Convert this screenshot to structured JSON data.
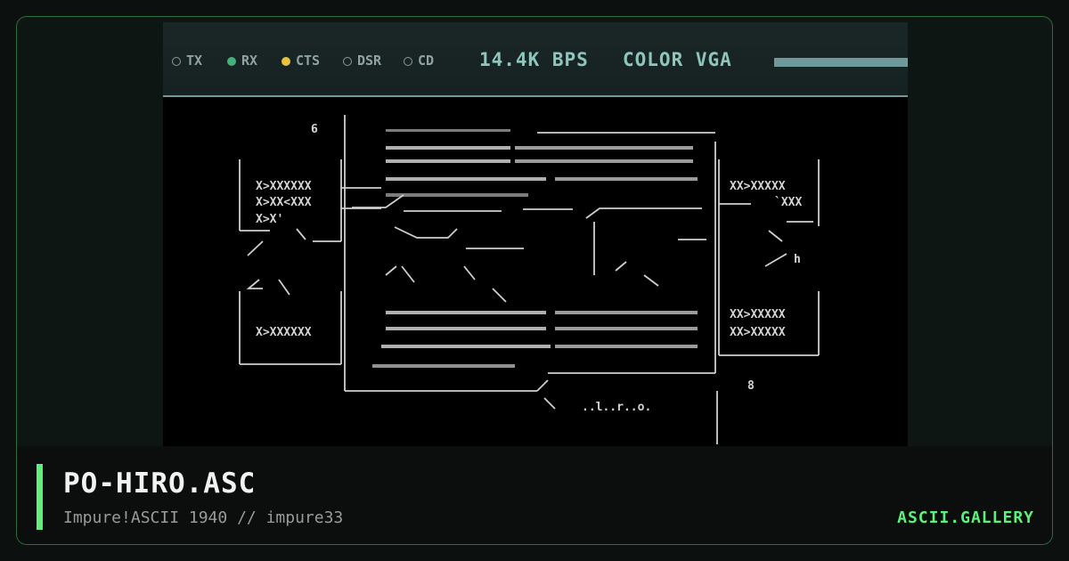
{
  "status_bar": {
    "indicators": [
      {
        "label": "TX",
        "state": "off",
        "icon": "led-off-icon"
      },
      {
        "label": "RX",
        "state": "on",
        "color": "#47b07a",
        "icon": "led-green-icon"
      },
      {
        "label": "CTS",
        "state": "on",
        "color": "#e8c33d",
        "icon": "led-yellow-icon"
      },
      {
        "label": "DSR",
        "state": "off",
        "icon": "led-off-icon"
      },
      {
        "label": "CD",
        "state": "off",
        "icon": "led-off-icon"
      }
    ],
    "baud_rate": "14.4K BPS",
    "display_mode": "COLOR VGA",
    "transfer_progress": 1.0
  },
  "art": {
    "glyph_rows": {
      "left_1": "X>XXXXXX",
      "left_2": "X>XX<XXX",
      "left_3": "X>X'",
      "left_4": "X>XXXXXX",
      "right_1": "XX>XXXXX",
      "right_2": "`XXX",
      "right_3": "XX>XXXXX",
      "right_4": "XX>XXXXX",
      "small_mark": "6",
      "corner_mark": "8",
      "tail_text": "..l..r..o.",
      "rabbit_mark": "h"
    }
  },
  "footer": {
    "title": "PO-HIRO.ASC",
    "subtitle": "Impure!ASCII 1940 // impure33",
    "brand": "ASCII.GALLERY"
  },
  "colors": {
    "accent": "#5ef07a",
    "frame_border": "#2f6b3c",
    "status_text": "#8ec6be",
    "led_green": "#47b07a",
    "led_yellow": "#e8c33d"
  }
}
